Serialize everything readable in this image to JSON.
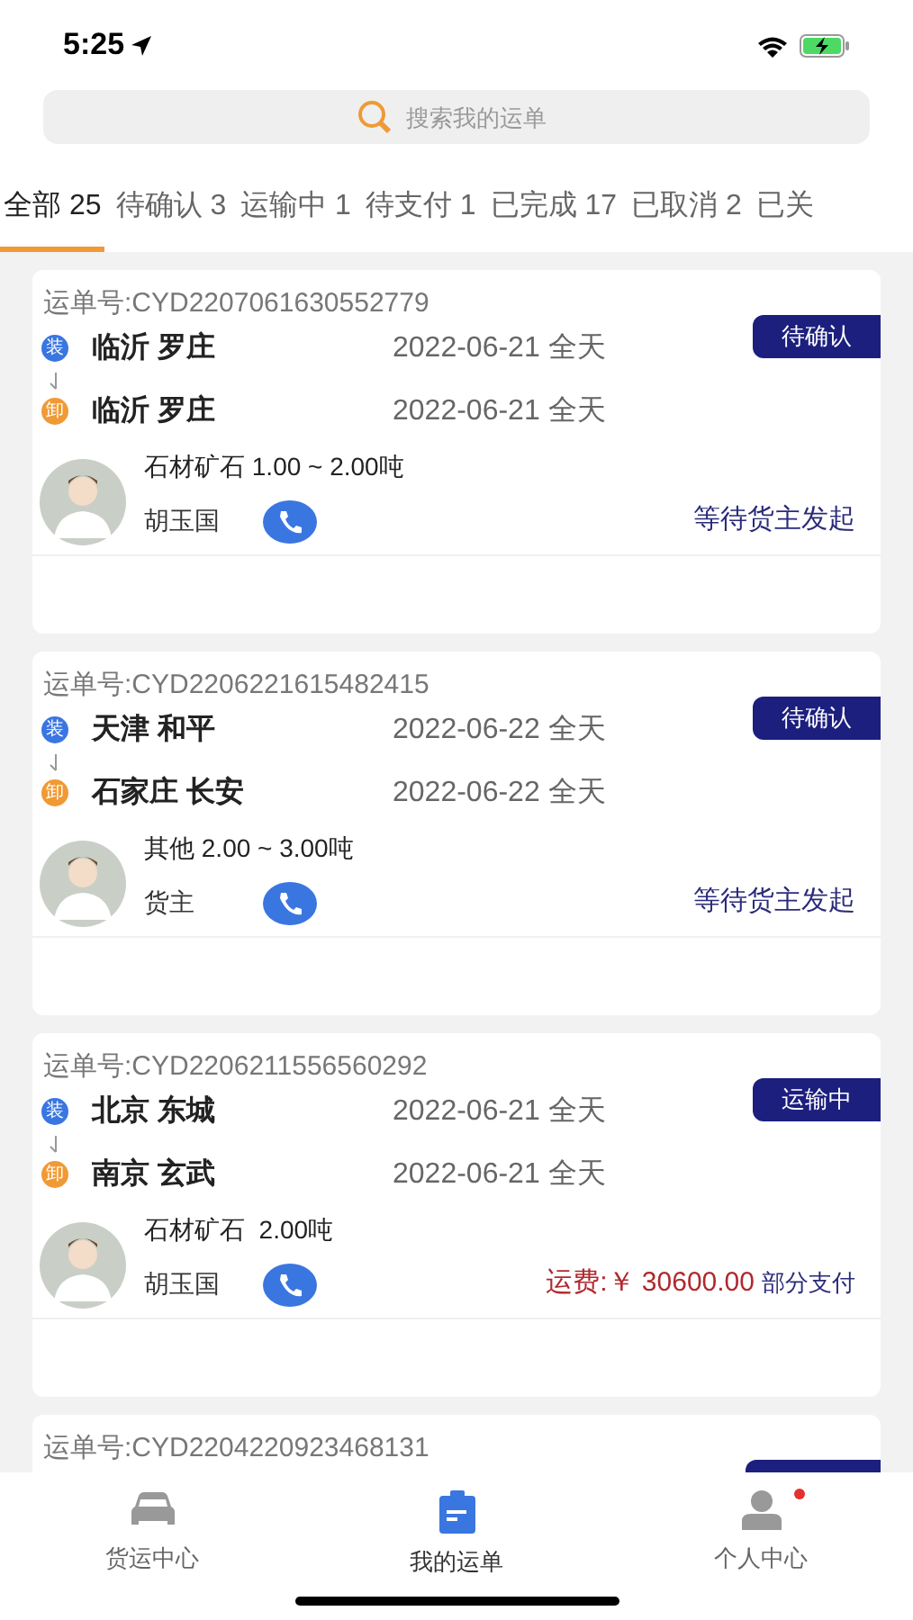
{
  "status_bar": {
    "time": "5:25"
  },
  "search": {
    "placeholder": "搜索我的运单"
  },
  "tabs": [
    {
      "label": "全部 25",
      "selected": true
    },
    {
      "label": "待确认 3",
      "selected": false
    },
    {
      "label": "运输中 1",
      "selected": false
    },
    {
      "label": "待支付 1",
      "selected": false
    },
    {
      "label": "已完成 17",
      "selected": false
    },
    {
      "label": "已取消 2",
      "selected": false
    },
    {
      "label": "已关",
      "selected": false
    }
  ],
  "orders": [
    {
      "order_no": "运单号:CYD2207061630552779",
      "badge": "待确认",
      "load_mark": "装",
      "load_city": "临沂 罗庄",
      "load_date": "2022-06-21 全天",
      "unload_mark": "卸",
      "unload_city": "临沂 罗庄",
      "unload_date": "2022-06-21 全天",
      "goods": "石材矿石 1.00 ~ 2.00吨",
      "contact": "胡玉国",
      "status": {
        "kind": "text",
        "text": "等待货主发起"
      }
    },
    {
      "order_no": "运单号:CYD2206221615482415",
      "badge": "待确认",
      "load_mark": "装",
      "load_city": "天津 和平",
      "load_date": "2022-06-22 全天",
      "unload_mark": "卸",
      "unload_city": "石家庄 长安",
      "unload_date": "2022-06-22 全天",
      "goods": "其他 2.00 ~ 3.00吨",
      "contact": "货主",
      "status": {
        "kind": "text",
        "text": "等待货主发起"
      }
    },
    {
      "order_no": "运单号:CYD2206211556560292",
      "badge": "运输中",
      "load_mark": "装",
      "load_city": "北京 东城",
      "load_date": "2022-06-21 全天",
      "unload_mark": "卸",
      "unload_city": "南京 玄武",
      "unload_date": "2022-06-21 全天",
      "goods": "石材矿石  2.00吨",
      "contact": "胡玉国",
      "status": {
        "kind": "fee",
        "fee": "运费:￥ 30600.00",
        "note": "部分支付"
      }
    },
    {
      "order_no": "运单号:CYD2204220923468131"
    }
  ],
  "nav": [
    {
      "label": "货运中心",
      "kind": "car",
      "selected": false,
      "dot": false
    },
    {
      "label": "我的运单",
      "kind": "clipboard",
      "selected": true,
      "dot": false
    },
    {
      "label": "个人中心",
      "kind": "person",
      "selected": false,
      "dot": true
    }
  ]
}
